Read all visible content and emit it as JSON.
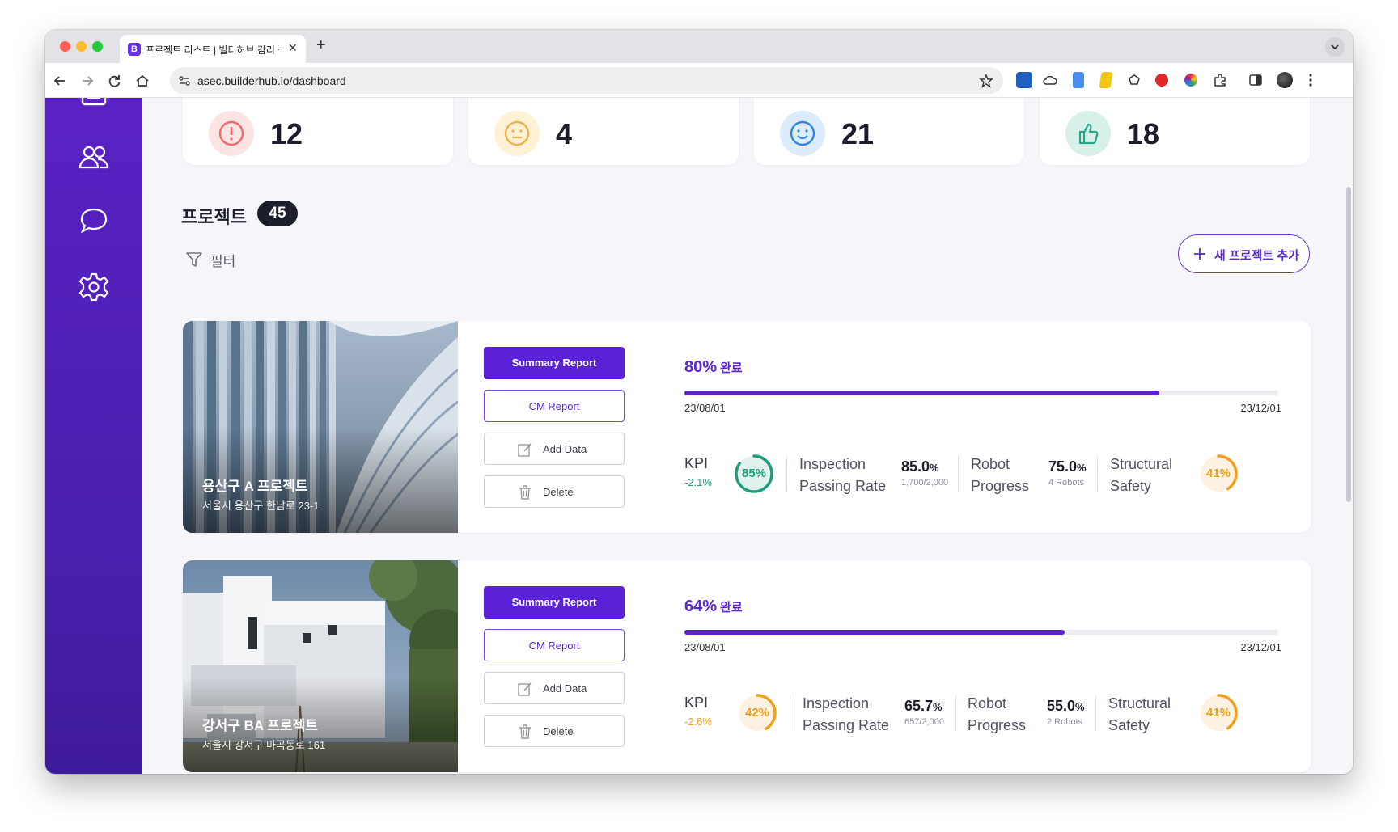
{
  "browser": {
    "tab_title": "프로젝트 리스트 | 빌더허브 감리 플",
    "tab_favicon": "B",
    "url": "asec.builderhub.io/dashboard"
  },
  "stats": [
    {
      "value": "12",
      "icon": "alert-icon",
      "color": "#f16a6a",
      "bg": "#fde4e4"
    },
    {
      "value": "4",
      "icon": "neutral-face-icon",
      "color": "#f0b14a",
      "bg": "#fff1d6"
    },
    {
      "value": "21",
      "icon": "smile-face-icon",
      "color": "#2f86e6",
      "bg": "#ddecfb"
    },
    {
      "value": "18",
      "icon": "thumbs-up-icon",
      "color": "#2aa58b",
      "bg": "#d7f1ea"
    }
  ],
  "section": {
    "title": "프로젝트",
    "count": "45",
    "filter_label": "필터",
    "add_button": "새 프로젝트 추가"
  },
  "accent": "#5a21d6",
  "projects": [
    {
      "name": "용산구 A 프로젝트",
      "address": "서울시 용산구 한남로 23-1",
      "buttons": {
        "summary": "Summary Report",
        "cm": "CM Report",
        "add": "Add Data",
        "delete": "Delete"
      },
      "progress_pct": "80%",
      "progress_suffix": "완료",
      "progress": 0.8,
      "start": "23/08/01",
      "end": "23/12/01",
      "kpi": {
        "label": "KPI",
        "delta": "-2.1%",
        "ring": "85%",
        "ring_value": 0.85,
        "ring_color": "#1f9c7c"
      },
      "inspection": {
        "label1": "Inspection",
        "label2": "Passing Rate",
        "value": "85.0",
        "unit": "%",
        "sub": "1,700/2,000"
      },
      "robot": {
        "label1": "Robot",
        "label2": "Progress",
        "value": "75.0",
        "unit": "%",
        "sub": "4 Robots"
      },
      "structural": {
        "label1": "Structural",
        "label2": "Safety",
        "ring": "41%",
        "ring_value": 0.41,
        "ring_color": "#f0a020"
      }
    },
    {
      "name": "강서구 BA 프로젝트",
      "address": "서울시 강서구 마곡동로 161",
      "buttons": {
        "summary": "Summary Report",
        "cm": "CM Report",
        "add": "Add Data",
        "delete": "Delete"
      },
      "progress_pct": "64%",
      "progress_suffix": "완료",
      "progress": 0.64,
      "start": "23/08/01",
      "end": "23/12/01",
      "kpi": {
        "label": "KPI",
        "delta": "-2.6%",
        "ring": "42%",
        "ring_value": 0.42,
        "ring_color": "#f0a020"
      },
      "inspection": {
        "label1": "Inspection",
        "label2": "Passing Rate",
        "value": "65.7",
        "unit": "%",
        "sub": "657/2,000"
      },
      "robot": {
        "label1": "Robot",
        "label2": "Progress",
        "value": "55.0",
        "unit": "%",
        "sub": "2 Robots"
      },
      "structural": {
        "label1": "Structural",
        "label2": "Safety",
        "ring": "41%",
        "ring_value": 0.41,
        "ring_color": "#f0a020"
      }
    }
  ]
}
